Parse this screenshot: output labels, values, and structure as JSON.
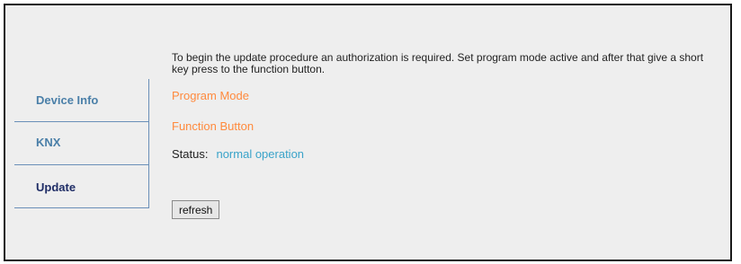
{
  "sidebar": {
    "items": [
      {
        "label": "Device Info"
      },
      {
        "label": "KNX"
      },
      {
        "label": "Update"
      }
    ]
  },
  "main": {
    "intro_text": "To begin the update procedure an authorization is required. Set program mode active and after that give a short key press to the function button.",
    "program_mode_label": "Program Mode",
    "function_button_label": "Function Button",
    "status_label": "Status:",
    "status_value": "normal operation",
    "refresh_label": "refresh"
  },
  "colors": {
    "accent_orange": "#ff8a3d",
    "status_blue": "#3aa3c9",
    "nav_blue": "#4a7fa8",
    "nav_active": "#1f2d66"
  }
}
